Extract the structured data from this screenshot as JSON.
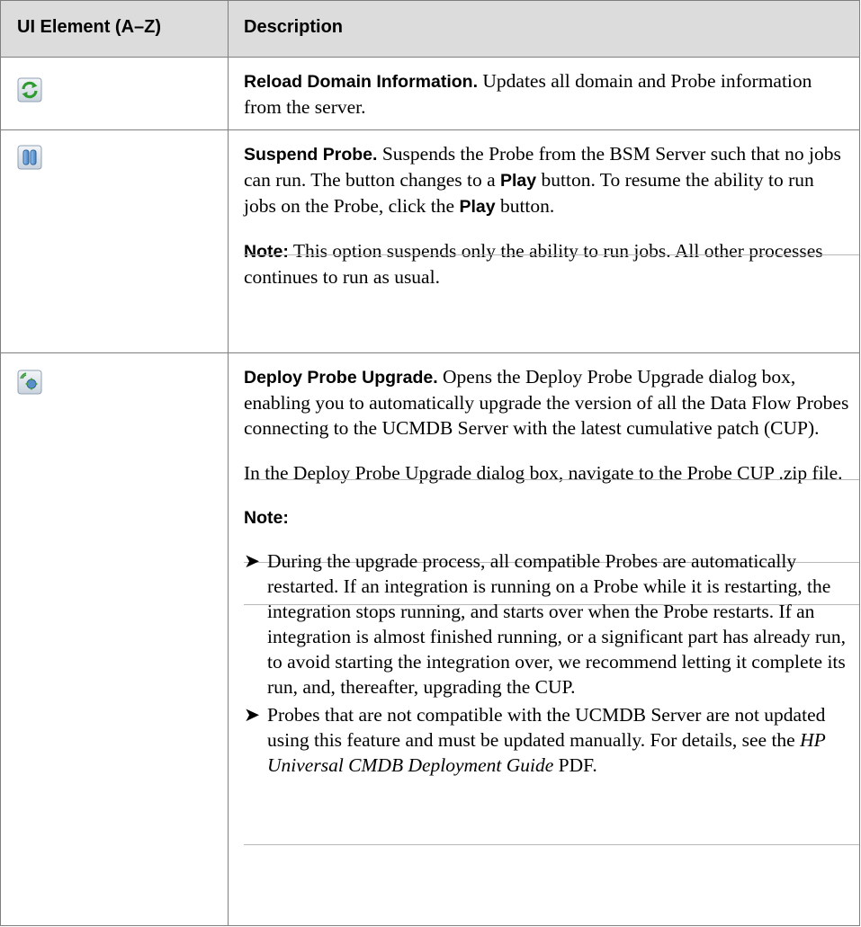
{
  "header": {
    "col1": "UI Element (A–Z)",
    "col2": "Description"
  },
  "rows": [
    {
      "icon": "reload-icon",
      "title": "Reload Domain Information.",
      "text": " Updates all domain and Probe information from the server."
    },
    {
      "icon": "pause-icon",
      "title": "Suspend Probe.",
      "text_a": " Suspends the Probe from the BSM Server such that no jobs can run. The button changes to a ",
      "play1": "Play",
      "text_b": " button. To resume the ability to run jobs on the Probe, click the ",
      "play2": "Play",
      "text_c": " button.",
      "note_label": "Note:",
      "note_text": " This option suspends only the ability to run jobs. All other processes continues to run as usual."
    },
    {
      "icon": "deploy-upgrade-icon",
      "title": "Deploy Probe Upgrade.",
      "text": " Opens the Deploy Probe Upgrade dialog box, enabling you to automatically upgrade the version of all the Data Flow Probes connecting to the UCMDB Server with the latest cumulative patch (CUP).",
      "para2": "In the Deploy Probe Upgrade dialog box, navigate to the Probe CUP .zip file.",
      "note_label": "Note:",
      "bullet_glyph": "➤",
      "bullet1": "During the upgrade process, all compatible Probes are automatically restarted. If an integration is running on a Probe while it is restarting, the integration stops running, and starts over when the Probe restarts. If an integration is almost finished running, or a significant part has already run, to avoid starting the integration over, we recommend letting it complete its run, and, thereafter, upgrading the CUP.",
      "bullet2_a": "Probes that are not compatible with the UCMDB Server are not updated using this feature and must be updated manually. For details, see the ",
      "bullet2_ref": "HP Universal CMDB Deployment Guide",
      "bullet2_b": " PDF."
    }
  ]
}
